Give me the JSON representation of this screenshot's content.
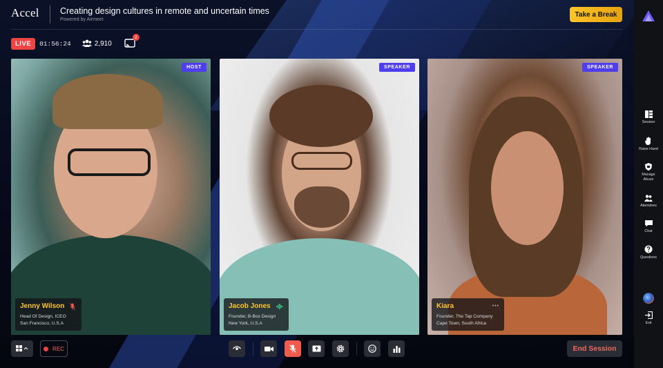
{
  "header": {
    "brand": "Accel",
    "event_title": "Creating design cultures in remote and uncertain times",
    "powered_by": "Powered by Airmeet",
    "break_button": "Take a Break"
  },
  "status": {
    "live": "LIVE",
    "timer": "01:56:24",
    "attendees": "2,910",
    "cast_badge": "2"
  },
  "speakers": [
    {
      "role": "HOST",
      "name": "Jenny Wilson",
      "title": "Head Of Design, ICEO",
      "location": "San Francisco, U.S.A",
      "audio": "muted",
      "audio_icon": "mic-off-icon"
    },
    {
      "role": "SPEAKER",
      "name": "Jacob Jones",
      "title": "Founder, B-Box Design",
      "location": "New York, U.S.A",
      "audio": "speaking",
      "audio_icon": "audio-wave-icon"
    },
    {
      "role": "SPEAKER",
      "name": "Kiara",
      "title": "Founder, The Tap Company",
      "location": "Cape Town, South Africa",
      "audio": "idle",
      "audio_icon": "dots-icon"
    }
  ],
  "controls": {
    "rec": "REC",
    "end_session": "End Session",
    "buttons": [
      "layout-icon",
      "eye-icon",
      "camera-icon",
      "mic-off-icon",
      "share-screen-icon",
      "settings-icon",
      "emoji-icon",
      "poll-icon"
    ]
  },
  "rail": {
    "items": [
      {
        "label": "Session",
        "icon": "session-icon"
      },
      {
        "label": "Raise Hand",
        "icon": "hand-icon"
      },
      {
        "label": "Manage Abuse",
        "icon": "shield-icon"
      },
      {
        "label": "Attendees",
        "icon": "people-icon"
      },
      {
        "label": "Chat",
        "icon": "chat-icon"
      },
      {
        "label": "Questions",
        "icon": "question-icon"
      },
      {
        "label": "Exit",
        "icon": "exit-icon"
      }
    ]
  },
  "colors": {
    "accent": "#ffc629",
    "live": "#ef4444",
    "role_tag": "#4f3ef0",
    "end": "#ef6a5c"
  }
}
